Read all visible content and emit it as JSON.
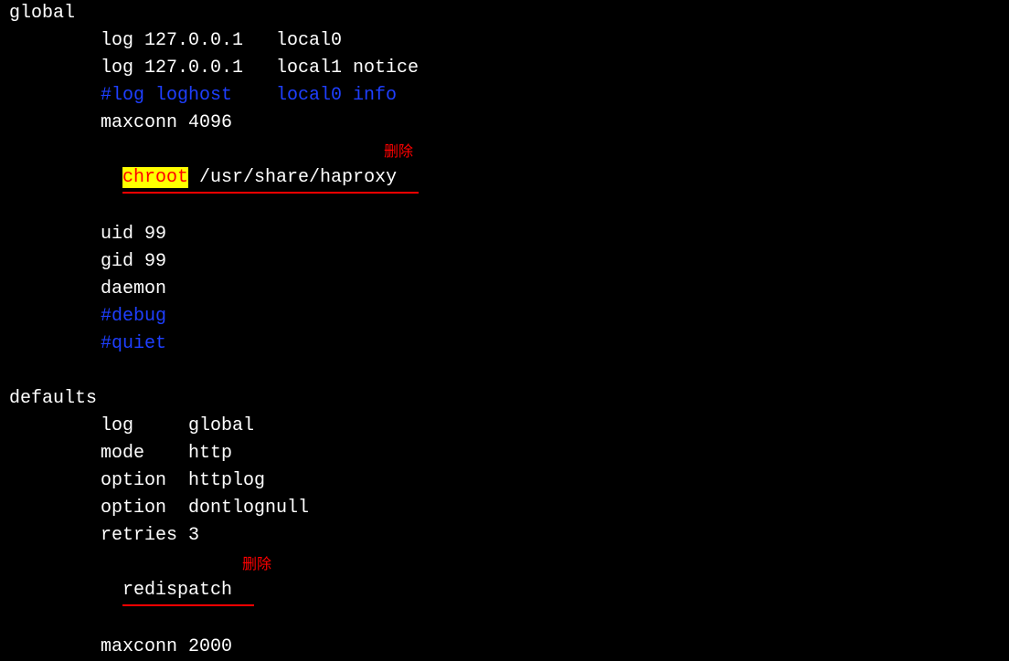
{
  "global": {
    "header": "global",
    "lines": {
      "log1": "log 127.0.0.1   local0",
      "log2": "log 127.0.0.1   local1 notice",
      "log_comment": "#log loghost    local0 info",
      "maxconn": "maxconn 4096",
      "chroot_prefix": "chroot",
      "chroot_suffix": " /usr/share/haproxy  ",
      "uid": "uid 99",
      "gid": "gid 99",
      "daemon": "daemon",
      "debug_comment": "#debug",
      "quiet_comment": "#quiet"
    }
  },
  "defaults": {
    "header": "defaults",
    "lines": {
      "log": "log     global",
      "mode": "mode    http",
      "option1": "option  httplog",
      "option2": "option  dontlognull",
      "retries": "retries 3",
      "redispatch": "redispatch  ",
      "maxconn": "maxconn 2000"
    }
  },
  "annotations": {
    "delete1": "删除",
    "delete2": "删除"
  }
}
